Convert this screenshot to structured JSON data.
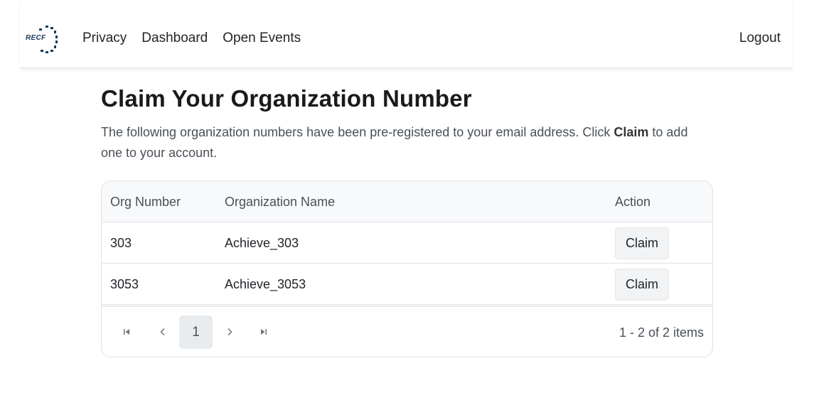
{
  "nav": {
    "logo_text": "RECF",
    "links": [
      "Privacy",
      "Dashboard",
      "Open Events"
    ],
    "logout": "Logout"
  },
  "main": {
    "title": "Claim Your Organization Number",
    "intro_before": "The following organization numbers have been pre-registered to your email address. Click ",
    "intro_bold": "Claim",
    "intro_after": " to add one to your account."
  },
  "table": {
    "headers": [
      "Org Number",
      "Organization Name",
      "Action"
    ],
    "rows": [
      {
        "org_number": "303",
        "org_name": "Achieve_303",
        "action": "Claim"
      },
      {
        "org_number": "3053",
        "org_name": "Achieve_3053",
        "action": "Claim"
      }
    ]
  },
  "pager": {
    "current_page": "1",
    "info": "1 - 2 of 2 items"
  },
  "colors": {
    "border": "#dee2e6",
    "header_bg": "#f8f9fa",
    "button_bg": "#f1f3f5",
    "logo": "#1b3a5c"
  }
}
